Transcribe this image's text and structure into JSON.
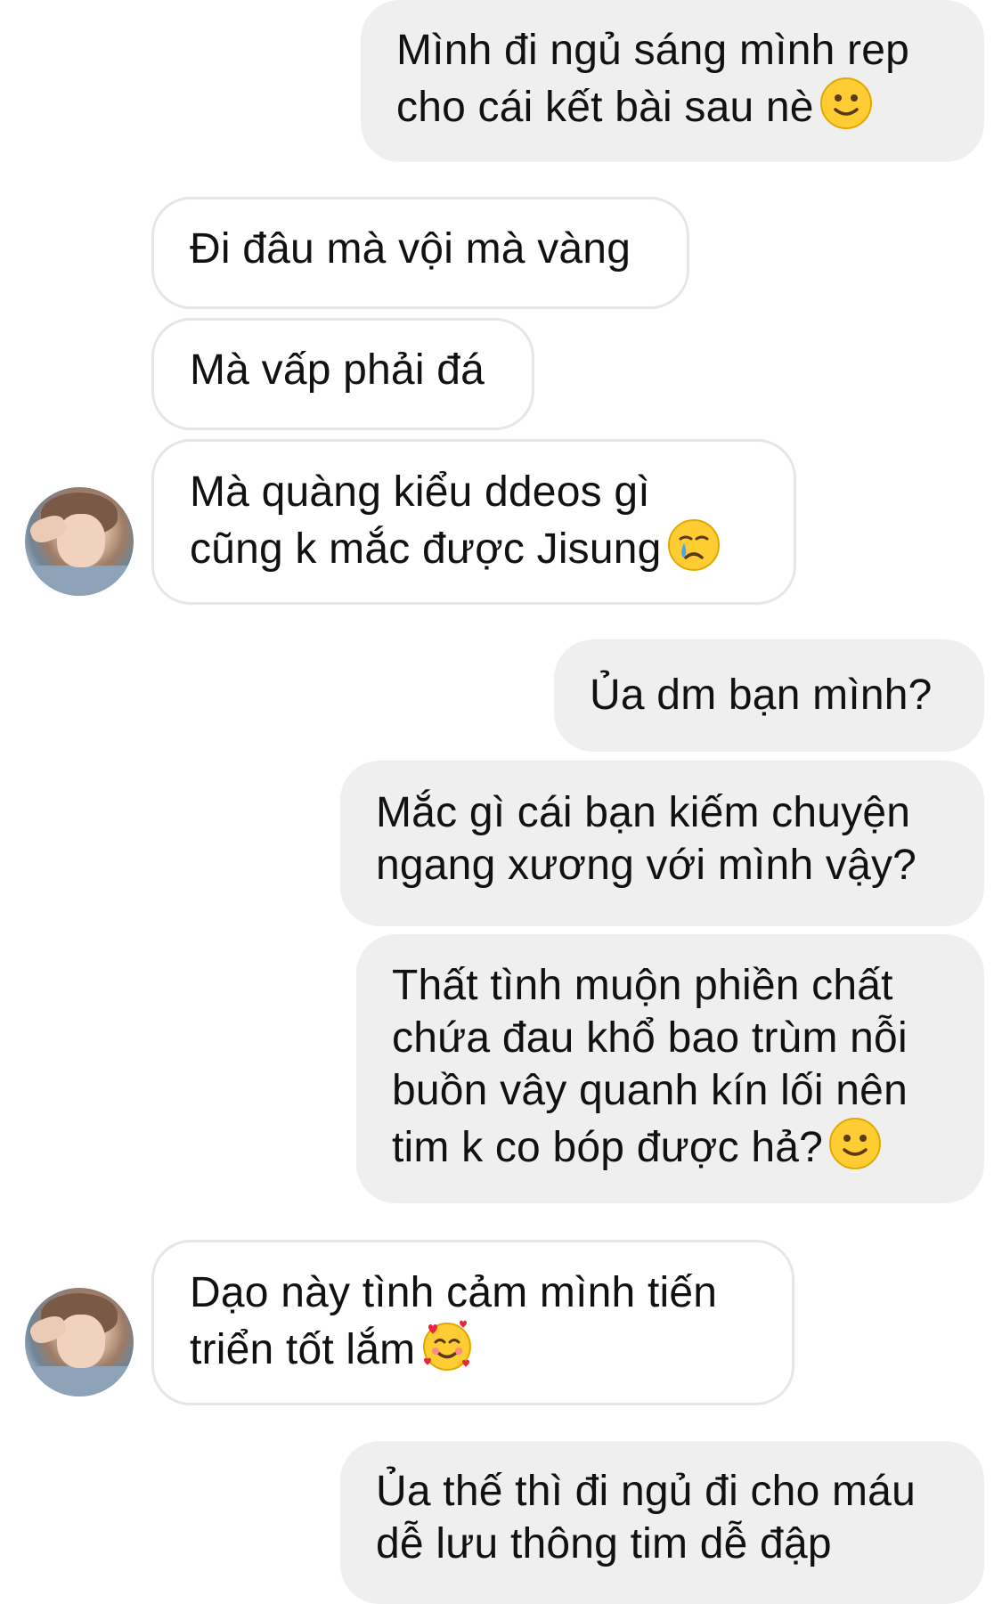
{
  "messages": [
    {
      "side": "sent",
      "lines": [
        "Mình đi ngủ sáng mình rep",
        "cho cái kết bài sau nè"
      ],
      "emoji": "slightly-smiling-face"
    },
    {
      "side": "received",
      "lines": [
        "Đi đâu mà vội mà vàng"
      ]
    },
    {
      "side": "received",
      "lines": [
        "Mà vấp phải đá"
      ]
    },
    {
      "side": "received",
      "lines": [
        "Mà quàng kiểu ddeos gì",
        "cũng k mắc được Jisung"
      ],
      "emoji": "crying-face"
    },
    {
      "side": "sent",
      "lines": [
        "Ủa dm bạn mình?"
      ]
    },
    {
      "side": "sent",
      "lines": [
        "Mắc gì cái bạn kiếm chuyện",
        "ngang xương với mình vậy?"
      ]
    },
    {
      "side": "sent",
      "lines": [
        "Thất tình muộn phiền chất",
        "chứa đau khổ bao trùm nỗi",
        "buồn vây quanh kín lối nên",
        "tim k co bóp được hả?"
      ],
      "emoji": "slightly-smiling-face"
    },
    {
      "side": "received",
      "lines": [
        "Dạo này tình cảm mình tiến",
        "triển tốt lắm"
      ],
      "emoji": "smiling-face-with-hearts"
    },
    {
      "side": "sent",
      "lines": [
        "Ủa thế thì đi ngủ đi cho máu",
        "dễ lưu thông tim dễ đập"
      ]
    }
  ],
  "colors": {
    "sent_bubble": "#efefef",
    "received_border": "#e6e6e6",
    "text": "#111111"
  }
}
